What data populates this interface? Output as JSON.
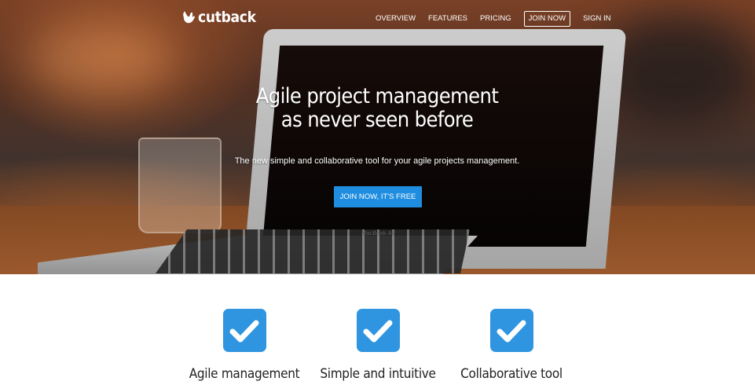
{
  "brand": {
    "name": "cutback",
    "logo_icon": "hand-rock-icon"
  },
  "nav": {
    "items": [
      {
        "label": "OVERVIEW"
      },
      {
        "label": "FEATURES"
      },
      {
        "label": "PRICING"
      },
      {
        "label": "JOIN NOW",
        "highlighted": true
      },
      {
        "label": "SIGN IN"
      }
    ]
  },
  "hero": {
    "title_line1": "Agile project management",
    "title_line2": "as never seen before",
    "subtitle": "The new simple and collaborative tool for your agile projects management.",
    "cta_label": "JOIN NOW, IT'S FREE",
    "laptop_label": "MacBook Air"
  },
  "features": [
    {
      "icon": "checkmark-icon",
      "title": "Agile management"
    },
    {
      "icon": "checkmark-icon",
      "title": "Simple and intuitive"
    },
    {
      "icon": "checkmark-icon",
      "title": "Collaborative tool"
    }
  ],
  "colors": {
    "accent": "#1f8ee0",
    "feature_icon_bg": "#2f95e0",
    "text_dark": "#222222"
  }
}
